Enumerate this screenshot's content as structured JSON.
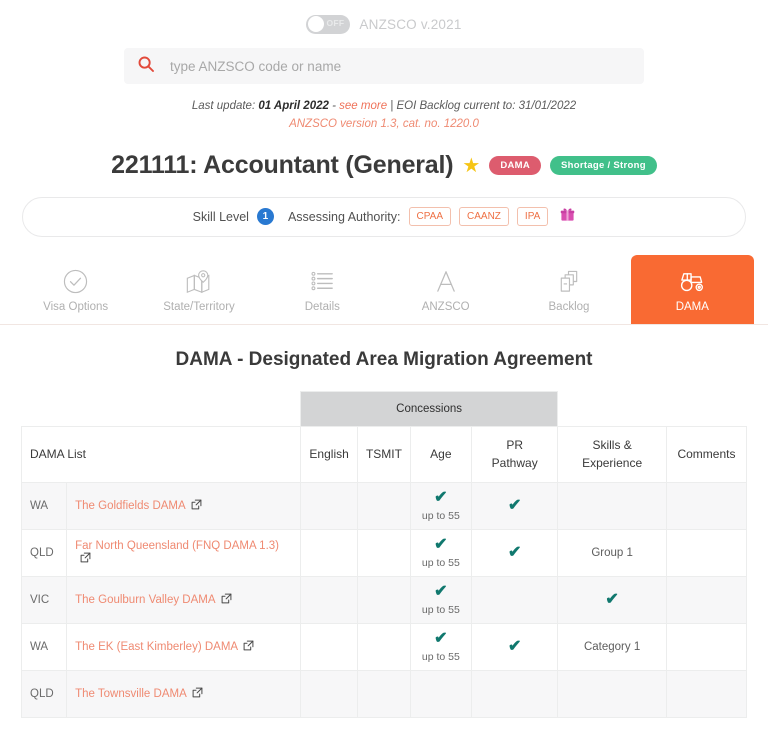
{
  "header": {
    "toggle": {
      "state_label": "OFF",
      "is_on": false,
      "name": "anzsco-version-toggle"
    },
    "version_label": "ANZSCO v.2021"
  },
  "search": {
    "placeholder": "type ANZSCO code or name",
    "value": "",
    "icon": "search-icon"
  },
  "updates": {
    "prefix": "Last update:",
    "date": "01 April 2022",
    "dash": "-",
    "see_more": "see more",
    "separator": "|",
    "backlog": "EOI Backlog current to: 31/01/2022",
    "version_line": "ANZSCO version 1.3, cat. no. 1220.0"
  },
  "occupation": {
    "title": "221111: Accountant (General)",
    "star_icon": "star-icon",
    "badges": [
      {
        "label": "DAMA",
        "color": "#dd5c6e"
      },
      {
        "label": "Shortage / Strong",
        "color": "#41c08a"
      }
    ]
  },
  "skill_bar": {
    "skill_label": "Skill Level",
    "skill_level": "1",
    "skill_level_color": "#2979d1",
    "authority_label": "Assessing Authority:",
    "authorities": [
      "CPAA",
      "CAANZ",
      "IPA"
    ],
    "gift_icon": "gift-icon",
    "gift_color": "#d94eb0"
  },
  "tabs": [
    {
      "label": "Visa Options",
      "icon": "check-circle-icon",
      "active": false
    },
    {
      "label": "State/Territory",
      "icon": "map-pin-icon",
      "active": false
    },
    {
      "label": "Details",
      "icon": "list-icon",
      "active": false
    },
    {
      "label": "ANZSCO",
      "icon": "letter-a-icon",
      "active": false
    },
    {
      "label": "Backlog",
      "icon": "boxes-icon",
      "active": false
    },
    {
      "label": "DAMA",
      "icon": "tractor-icon",
      "active": true
    }
  ],
  "active_tab_color": "#f96a33",
  "section": {
    "heading": "DAMA - Designated Area Migration Agreement"
  },
  "table": {
    "group_header": "Concessions",
    "columns": [
      "DAMA List",
      "English",
      "TSMIT",
      "Age",
      "PR Pathway",
      "Skills & Experience",
      "Comments"
    ],
    "column_pr_line1": "PR",
    "column_pr_line2": "Pathway",
    "column_skills_line1": "Skills &",
    "column_skills_line2": "Experience",
    "rows": [
      {
        "state": "WA",
        "name": "The Goldfields DAMA",
        "link_icon": "external-link-icon",
        "english": "",
        "tsmit": "",
        "age_check": true,
        "age_note": "up to 55",
        "pr_check": true,
        "skills": "",
        "skills_check": false,
        "comments": "",
        "shaded": true
      },
      {
        "state": "QLD",
        "name": "Far North Queensland (FNQ DAMA 1.3)",
        "link_icon": "external-link-icon",
        "english": "",
        "tsmit": "",
        "age_check": true,
        "age_note": "up to 55",
        "pr_check": true,
        "skills": "Group 1",
        "skills_check": false,
        "comments": "",
        "shaded": false
      },
      {
        "state": "VIC",
        "name": "The Goulburn Valley DAMA",
        "link_icon": "external-link-icon",
        "english": "",
        "tsmit": "",
        "age_check": true,
        "age_note": "up to 55",
        "pr_check": false,
        "skills": "",
        "skills_check": true,
        "comments": "",
        "shaded": true
      },
      {
        "state": "WA",
        "name": "The EK (East Kimberley) DAMA",
        "link_icon": "external-link-icon",
        "english": "",
        "tsmit": "",
        "age_check": true,
        "age_note": "up to 55",
        "pr_check": true,
        "skills": "Category 1",
        "skills_check": false,
        "comments": "",
        "shaded": false
      },
      {
        "state": "QLD",
        "name": "The Townsville DAMA",
        "link_icon": "external-link-icon",
        "english": "",
        "tsmit": "",
        "age_check": false,
        "age_note": "",
        "pr_check": false,
        "skills": "",
        "skills_check": false,
        "comments": "",
        "shaded": true
      }
    ],
    "check_glyph": "✔",
    "check_color": "#10786e"
  }
}
